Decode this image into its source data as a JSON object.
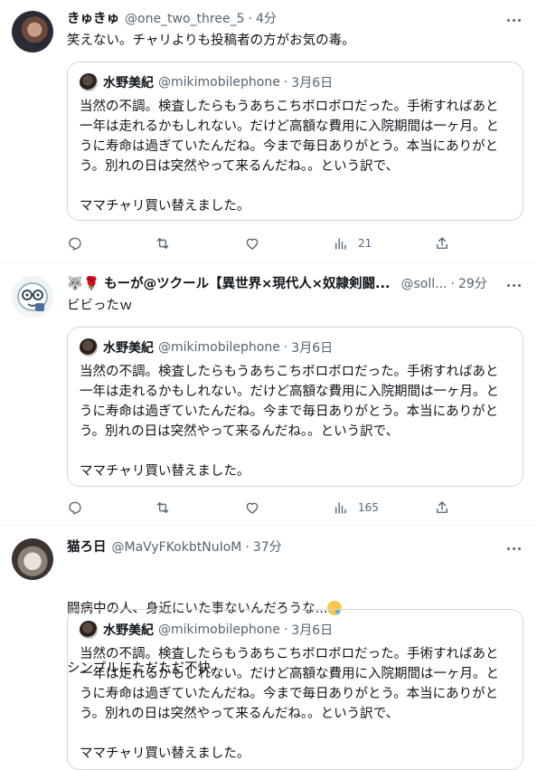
{
  "quoted": {
    "name": "水野美紀",
    "handle": "@mikimobilephone",
    "time": "3月6日",
    "text": "当然の不調。検査したらもうあちこちボロボロだった。手術すればあと\n一年は走れるかもしれない。だけど高額な費用に入院期間は一ヶ月。と\nうに寿命は過ぎていたんだね。今まで毎日ありがとう。本当にありがと\nう。別れの日は突然やって来るんだね。。という訳で、\n\nママチャリ買い替えました。"
  },
  "tweets": [
    {
      "name": "きゅきゅ",
      "handle": "@one_two_three_5",
      "time": "4分",
      "text": "笑えない。チャリよりも投稿者の方がお気の毒。",
      "views": "21",
      "avatar_icon": "user-avatar-icon"
    },
    {
      "name": "🐺🌹 もーが@ツクール【異世界×現代人×奴隷剣闘...",
      "handle": "@soll...",
      "time": "29分",
      "text": "ビビったｗ",
      "views": "165",
      "avatar_icon": "ghost-avatar-icon"
    },
    {
      "name": "猫ろ日",
      "handle": "@MaVyFKokbtNuIoM",
      "time": "37分",
      "text_line1": "闘病中の人、身近にいた事ないんだろうな...",
      "text_line2": "シンプルにただただ不快。",
      "views": "",
      "avatar_icon": "cat-avatar-icon"
    }
  ],
  "icons": {
    "reply": "reply-icon",
    "retweet": "retweet-icon",
    "like": "heart-icon",
    "views": "views-chart-icon",
    "share": "share-icon",
    "more": "more-icon"
  }
}
